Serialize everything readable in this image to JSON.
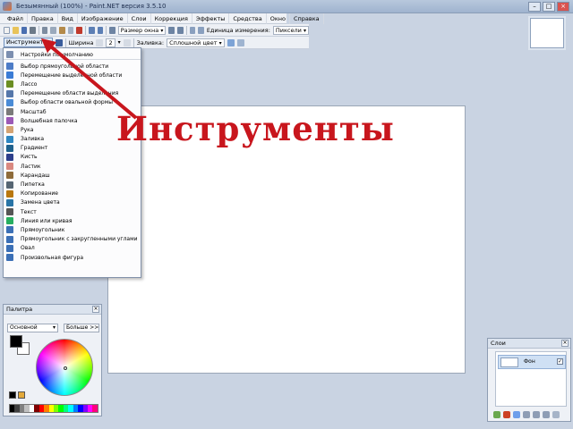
{
  "window": {
    "title": "Безымянный (100%) - Paint.NET версия 3.5.10",
    "minimize": "–",
    "maximize": "□",
    "close": "×"
  },
  "menu": [
    "Файл",
    "Правка",
    "Вид",
    "Изображение",
    "Слои",
    "Коррекция",
    "Эффекты",
    "Средства",
    "Окно",
    "Справка"
  ],
  "toolbar1": {
    "zoom_label": "Размер окна",
    "units_label": "Единица измерения:",
    "units_value": "Пиксели"
  },
  "toolbar2": {
    "tool_label": "Инструмент:",
    "width_label": "Ширина",
    "width_value": "2",
    "fill_label": "Заливка:",
    "fill_value": "Сплошной цвет"
  },
  "tool_menu": {
    "items": [
      "Настройки по умолчанию",
      "Выбор прямоугольной области",
      "Перемещение выделенной области",
      "Лассо",
      "Перемещение области выделения",
      "Выбор области овальной формы",
      "Масштаб",
      "Волшебная палочка",
      "Рука",
      "Заливка",
      "Градиент",
      "Кисть",
      "Ластик",
      "Карандаш",
      "Пипетка",
      "Копирование",
      "Замена цвета",
      "Текст",
      "Линия или кривая",
      "Прямоугольник",
      "Прямоугольник с закругленными углами",
      "Овал",
      "Произвольная фигура"
    ],
    "icon_colors": [
      "#7c8fb0",
      "#4d7cc7",
      "#3a7bd5",
      "#6b8e23",
      "#5577aa",
      "#4a8bd6",
      "#7a7a7a",
      "#9b59b6",
      "#d4a373",
      "#2e86c1",
      "#1f618d",
      "#2d3e8b",
      "#d98880",
      "#8e6b3a",
      "#566573",
      "#b9770e",
      "#2874a6",
      "#555",
      "#27ae60",
      "#3b6fb6",
      "#3b6fb6",
      "#3b6fb6",
      "#3b6fb6"
    ]
  },
  "annotation": "Инструменты",
  "annotation_color": "#c8161d",
  "palette": {
    "title": "Палитра",
    "mode": "Основной",
    "more_button": "Больше >>"
  },
  "layers": {
    "title": "Слои",
    "layer_name": "Фон"
  },
  "colors": {
    "accent": "#c8161d",
    "workspace": "#c9d3e2"
  }
}
